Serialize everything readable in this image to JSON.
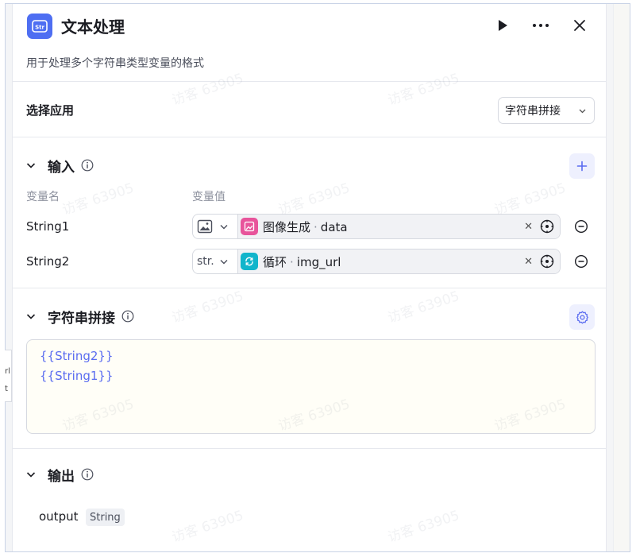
{
  "header": {
    "title": "文本处理",
    "app_icon_label": "Str",
    "description": "用于处理多个字符串类型变量的格式"
  },
  "select_app": {
    "label": "选择应用",
    "value": "字符串拼接"
  },
  "input_section": {
    "title": "输入",
    "col_name": "变量名",
    "col_value": "变量值",
    "rows": [
      {
        "name": "String1",
        "type_label": "",
        "type_icon": "image-icon",
        "ref_node": "图像生成",
        "ref_var": "data",
        "ref_color": "#e8549b",
        "ref_icon": "image-gen-icon"
      },
      {
        "name": "String2",
        "type_label": "str.",
        "type_icon": "",
        "ref_node": "循环",
        "ref_var": "img_url",
        "ref_color": "#12b5cb",
        "ref_icon": "loop-icon"
      }
    ]
  },
  "concat_section": {
    "title": "字符串拼接",
    "template_lines": [
      "{{String2}}",
      "{{String1}}"
    ]
  },
  "output_section": {
    "title": "输出",
    "var_name": "output",
    "var_type": "String"
  },
  "background": {
    "card_lines": [
      "rl",
      "t"
    ]
  },
  "watermark_text": "访客 63905",
  "colors": {
    "accent": "#4e6ef2",
    "button_tint": "#eef0fe",
    "template_text": "#5a6cf0",
    "template_bg": "#fffef7"
  }
}
